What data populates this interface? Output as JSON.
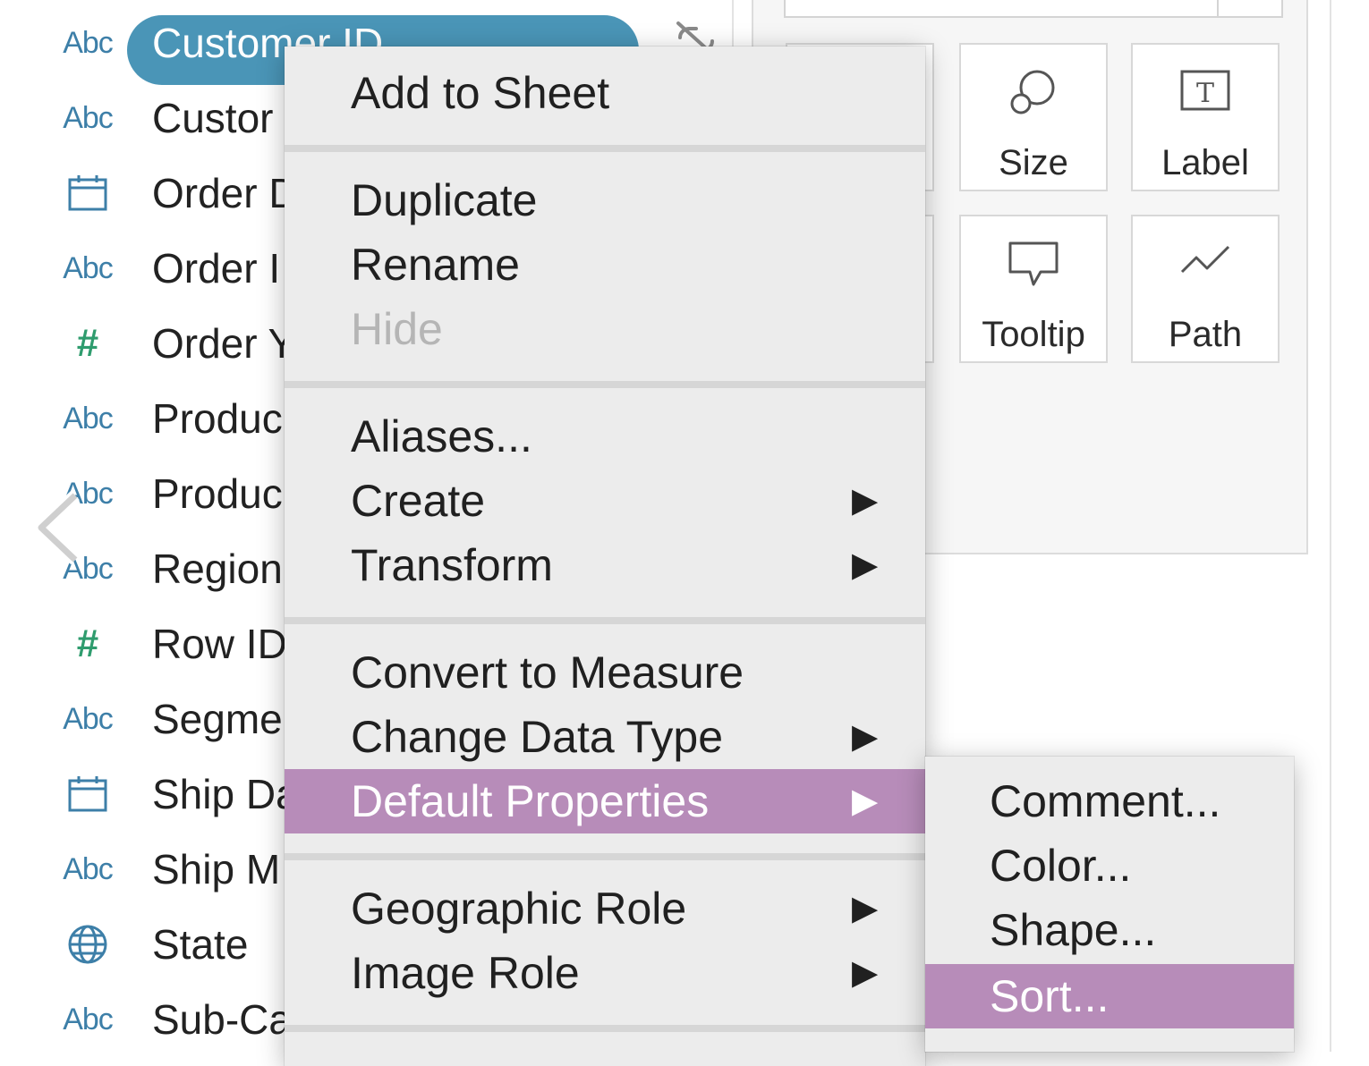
{
  "fields": [
    {
      "type": "Abc",
      "label": "Customer ID",
      "selected": true
    },
    {
      "type": "Abc",
      "label": "Custor"
    },
    {
      "type": "date-icon",
      "label": "Order D"
    },
    {
      "type": "Abc",
      "label": "Order I"
    },
    {
      "type": "#",
      "label": "Order Y"
    },
    {
      "type": "Abc",
      "label": "Produc"
    },
    {
      "type": "Abc",
      "label": "Produc"
    },
    {
      "type": "Abc",
      "label": "Region"
    },
    {
      "type": "#",
      "label": "Row ID"
    },
    {
      "type": "Abc",
      "label": "Segme"
    },
    {
      "type": "date-icon",
      "label": "Ship Da"
    },
    {
      "type": "Abc",
      "label": "Ship M"
    },
    {
      "type": "globe-icon",
      "label": "State"
    },
    {
      "type": "Abc",
      "label": "Sub-Ca"
    }
  ],
  "marks": {
    "buttons": [
      {
        "label": "Size",
        "icon": "size-icon"
      },
      {
        "label": "Label",
        "icon": "label-icon"
      },
      {
        "label": "Tooltip",
        "icon": "tooltip-icon"
      },
      {
        "label": "Path",
        "icon": "path-icon"
      }
    ]
  },
  "context_menu": {
    "items": [
      {
        "label": "Add to Sheet"
      },
      {
        "label": "Duplicate"
      },
      {
        "label": "Rename"
      },
      {
        "label": "Hide",
        "disabled": true
      },
      {
        "label": "Aliases..."
      },
      {
        "label": "Create",
        "submenu": true
      },
      {
        "label": "Transform",
        "submenu": true
      },
      {
        "label": "Convert to Measure"
      },
      {
        "label": "Change Data Type",
        "submenu": true
      },
      {
        "label": "Default Properties",
        "submenu": true,
        "highlighted": true
      },
      {
        "label": "Geographic Role",
        "submenu": true
      },
      {
        "label": "Image Role",
        "submenu": true
      }
    ],
    "arrow": "▶"
  },
  "submenu": {
    "items": [
      {
        "label": "Comment..."
      },
      {
        "label": "Color..."
      },
      {
        "label": "Shape..."
      },
      {
        "label": "Sort...",
        "highlighted": true
      }
    ]
  },
  "colors": {
    "selected_pill": "#4a95b7",
    "highlight": "#b78cb9",
    "abc_icon": "#3d7fa8",
    "num_icon": "#2f9c6e"
  }
}
